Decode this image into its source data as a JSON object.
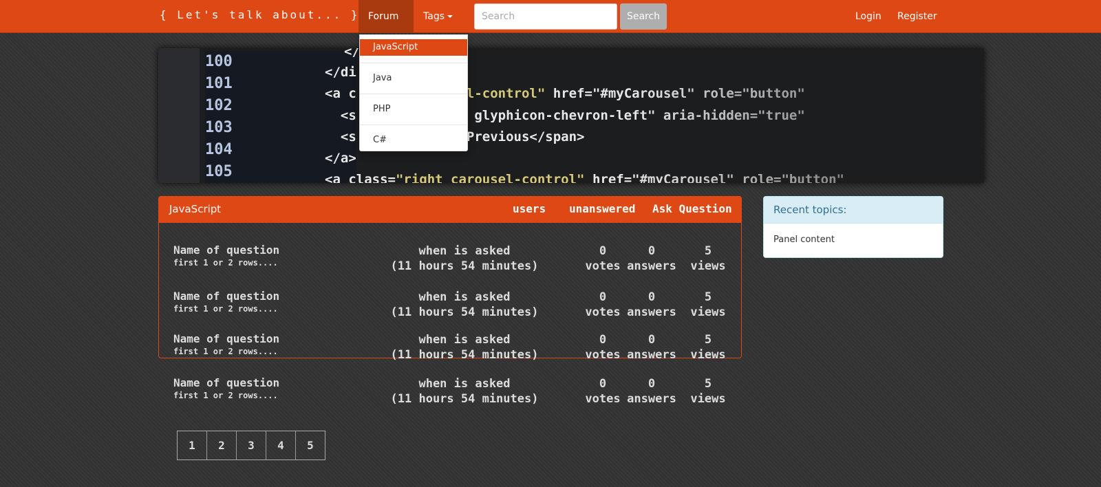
{
  "navbar": {
    "brand": "{ Let's talk about... }",
    "forum_label": "Forum",
    "tags_label": "Tags",
    "search_placeholder": "Search",
    "search_button": "Search",
    "login": "Login",
    "register": "Register"
  },
  "dropdown": {
    "items": [
      "JavaScript",
      "Java",
      "PHP",
      "C#"
    ]
  },
  "banner": {
    "line_numbers": [
      "100",
      "101",
      "102",
      "103",
      "104",
      "105"
    ]
  },
  "main_panel": {
    "title": "JavaScript",
    "links": {
      "users": "users",
      "unanswered": "unanswered",
      "ask": "Ask Question"
    },
    "questions": [
      {
        "name": "Name of question",
        "snippet": "first 1 or 2 rows....",
        "when_label": "when is asked",
        "when_value": "(11 hours 54 minutes)",
        "votes": "0",
        "votes_label": "votes",
        "answers": "0",
        "answers_label": "answers",
        "views": "5",
        "views_label": "views"
      },
      {
        "name": "Name of question",
        "snippet": "first 1 or 2 rows....",
        "when_label": "when is asked",
        "when_value": "(11 hours 54 minutes)",
        "votes": "0",
        "votes_label": "votes",
        "answers": "0",
        "answers_label": "answers",
        "views": "5",
        "views_label": "views"
      },
      {
        "name": "Name of question",
        "snippet": "first 1 or 2 rows....",
        "when_label": "when is asked",
        "when_value": "(11 hours 54 minutes)",
        "votes": "0",
        "votes_label": "votes",
        "answers": "0",
        "answers_label": "answers",
        "views": "5",
        "views_label": "views"
      },
      {
        "name": "Name of question",
        "snippet": "first 1 or 2 rows....",
        "when_label": "when is asked",
        "when_value": "(11 hours 54 minutes)",
        "votes": "0",
        "votes_label": "votes",
        "answers": "0",
        "answers_label": "answers",
        "views": "5",
        "views_label": "views"
      }
    ]
  },
  "pagination": [
    "1",
    "2",
    "3",
    "4",
    "5"
  ],
  "side_panel": {
    "title": "Recent topics:",
    "content": "Panel content"
  },
  "colors": {
    "brand": "#dd4814",
    "background": "#333333",
    "info_panel_heading": "#d9edf7"
  }
}
